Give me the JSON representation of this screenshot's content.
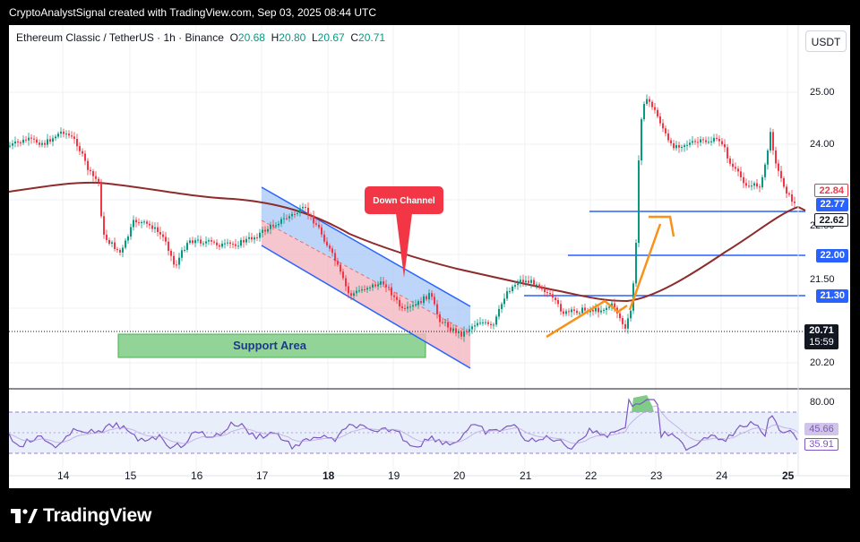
{
  "header": {
    "credit": "CryptoAnalystSignal created with TradingView.com, Sep 03, 2025 08:44 UTC"
  },
  "symbol_line": {
    "name": "Ethereum Classic / TetherUS · 1h · Binance",
    "o_label": "O",
    "o": "20.68",
    "h_label": "H",
    "h": "20.80",
    "l_label": "L",
    "l": "20.67",
    "c_label": "C",
    "c": "20.71"
  },
  "currency_button": "USDT",
  "annotations": {
    "channel_label": "Down Channel",
    "support_label": "Support Area"
  },
  "price_axis": {
    "ticks": [
      "25.00",
      "24.00",
      "22.50",
      "21.50",
      "20.20"
    ],
    "level_labels": [
      "22.00",
      "21.30"
    ],
    "current_price": "20.71",
    "countdown": "15:59",
    "marker_high": "22.84",
    "marker_mid": "22.77",
    "marker_low": "22.62"
  },
  "rsi_axis": {
    "ticks": [
      "80.00"
    ],
    "value_a": "45.66",
    "value_b": "35.91"
  },
  "time_axis": [
    "14",
    "15",
    "16",
    "17",
    "18",
    "19",
    "20",
    "21",
    "22",
    "23",
    "24",
    "25"
  ],
  "colors": {
    "up": "#089981",
    "down": "#f23645",
    "ma": "#8e2b2b",
    "level": "#2962ff",
    "arrow": "#f7931a",
    "rsi": "#7e57c2"
  },
  "footer": {
    "brand": "TradingView",
    "logo_icon": "tradingview-logo-icon"
  }
}
